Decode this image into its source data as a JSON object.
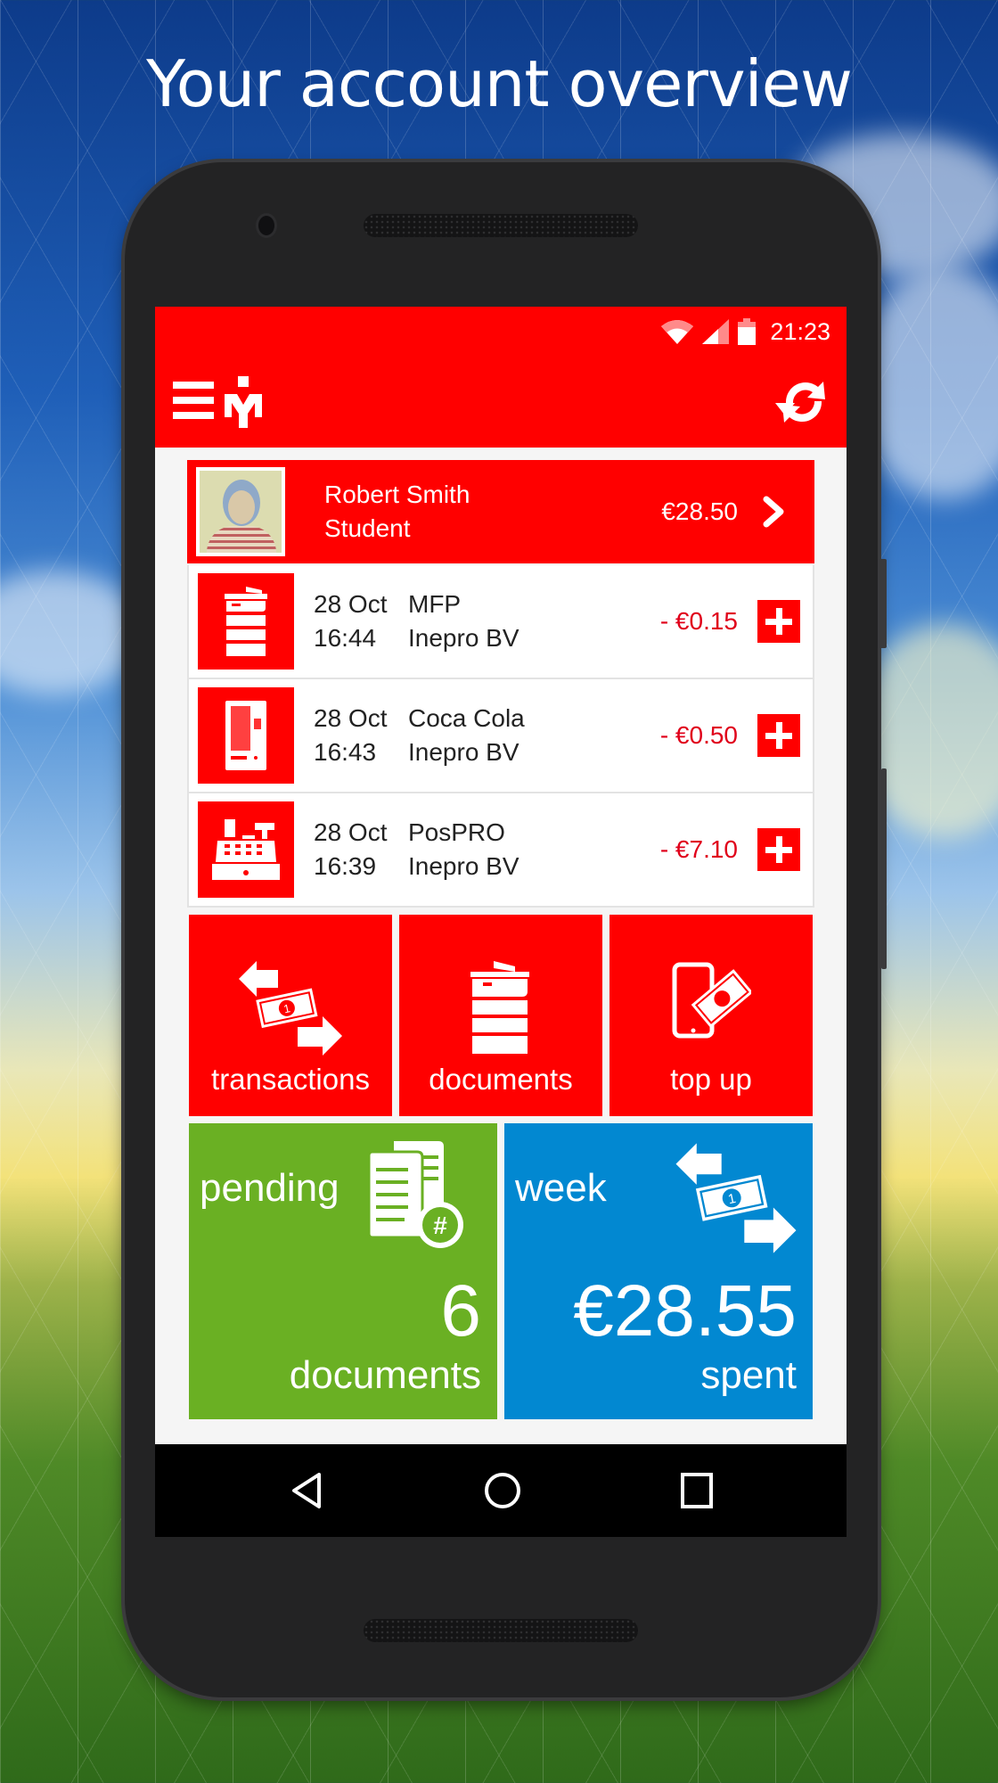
{
  "headline": "Your account overview",
  "status_bar": {
    "time": "21:23",
    "icons": [
      "wifi-icon",
      "signal-icon",
      "battery-icon"
    ]
  },
  "app_bar": {
    "menu_icon": "hamburger-menu-icon",
    "logo_icon": "app-logo-icon",
    "refresh_icon": "refresh-icon"
  },
  "profile": {
    "name": "Robert Smith",
    "role": "Student",
    "balance": "€28.50",
    "chevron_icon": "chevron-right-icon"
  },
  "transactions": [
    {
      "icon": "printer-icon",
      "date": "28 Oct",
      "time": "16:44",
      "name": "MFP",
      "vendor": "Inepro BV",
      "amount": "- €0.15"
    },
    {
      "icon": "vending-machine-icon",
      "date": "28 Oct",
      "time": "16:43",
      "name": "Coca Cola",
      "vendor": "Inepro BV",
      "amount": "- €0.50"
    },
    {
      "icon": "cash-register-icon",
      "date": "28 Oct",
      "time": "16:39",
      "name": "PosPRO",
      "vendor": "Inepro BV",
      "amount": "- €7.10"
    }
  ],
  "tiles": [
    {
      "label": "transactions",
      "icon": "money-exchange-icon"
    },
    {
      "label": "documents",
      "icon": "printer-icon"
    },
    {
      "label": "top up",
      "icon": "phone-money-icon"
    }
  ],
  "summary": {
    "pending": {
      "title": "pending",
      "value": "6",
      "unit": "documents",
      "icon": "documents-hash-icon",
      "color": "#6ab023"
    },
    "week": {
      "title": "week",
      "value": "€28.55",
      "unit": "spent",
      "icon": "money-exchange-icon",
      "color": "#0288d1"
    }
  },
  "nav_bar": {
    "back": "back-icon",
    "home": "home-icon",
    "recents": "recents-icon"
  },
  "colors": {
    "accent": "#ff0000",
    "amount_negative": "#e0001a"
  }
}
